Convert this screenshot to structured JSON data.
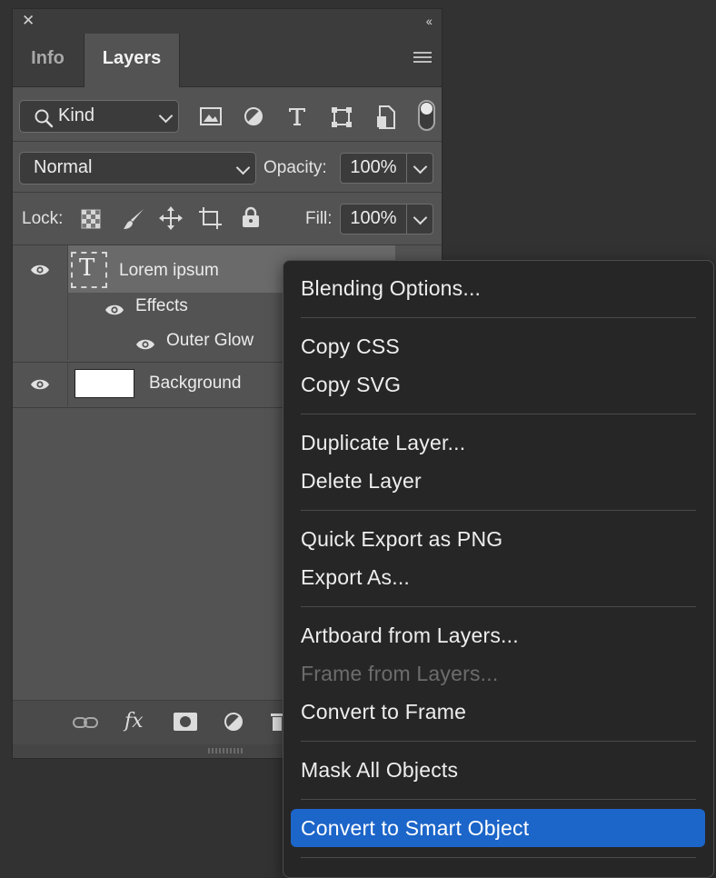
{
  "panel": {
    "tabs": [
      {
        "label": "Info"
      },
      {
        "label": "Layers"
      }
    ],
    "filter": {
      "kind_label": "Kind",
      "filter_icons": [
        "image-filter-icon",
        "adjustment-filter-icon",
        "type-filter-icon",
        "shape-filter-icon",
        "smart-object-filter-icon"
      ]
    },
    "blend": {
      "mode": "Normal",
      "opacity_label": "Opacity:",
      "opacity_value": "100%"
    },
    "lock": {
      "label": "Lock:",
      "fill_label": "Fill:",
      "fill_value": "100%"
    },
    "layers": [
      {
        "name": "Lorem ipsum",
        "type_glyph": "T"
      },
      {
        "name": "Effects"
      },
      {
        "name": "Outer Glow"
      },
      {
        "name": "Background"
      }
    ],
    "bottom_fx": "fx"
  },
  "context_menu": {
    "items": [
      {
        "label": "Blending Options...",
        "disabled": false
      },
      {
        "label": "Copy CSS",
        "disabled": false
      },
      {
        "label": "Copy SVG",
        "disabled": false
      },
      {
        "label": "Duplicate Layer...",
        "disabled": false
      },
      {
        "label": "Delete Layer",
        "disabled": false
      },
      {
        "label": "Quick Export as PNG",
        "disabled": false
      },
      {
        "label": "Export As...",
        "disabled": false
      },
      {
        "label": "Artboard from Layers...",
        "disabled": false
      },
      {
        "label": "Frame from Layers...",
        "disabled": true
      },
      {
        "label": "Convert to Frame",
        "disabled": false
      },
      {
        "label": "Mask All Objects",
        "disabled": false
      },
      {
        "label": "Convert to Smart Object",
        "disabled": false,
        "highlighted": true
      }
    ]
  },
  "colors": {
    "highlight": "#1c65c9",
    "panel_bg": "#535353",
    "menu_bg": "#262626"
  }
}
